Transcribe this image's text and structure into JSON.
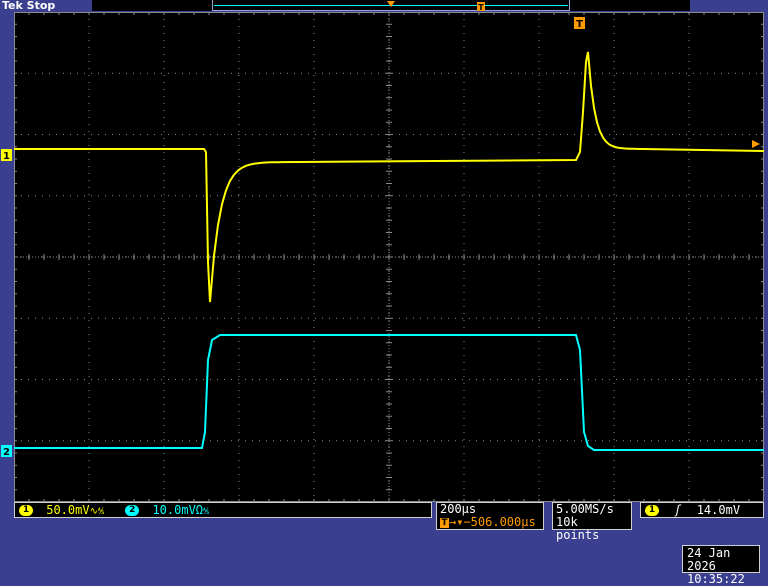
{
  "header": {
    "brand": "Tek Stop",
    "trigger_pos_marker": "T"
  },
  "screen": {
    "trigger_marker": "T",
    "ch1_marker": "1",
    "ch2_marker": "2",
    "colors": {
      "ch1": "#ffff00",
      "ch2": "#00ffff",
      "grid": "#8a8a8a",
      "background": "#000000"
    }
  },
  "status": {
    "ch1_badge": "1",
    "ch1_scale": "50.0mV",
    "ch1_suffix": "∿⅍",
    "ch2_badge": "2",
    "ch2_scale": "10.0mVΩ",
    "ch2_suffix": "⅍",
    "timebase": "200µs",
    "trigger_icon": "T",
    "trigger_offset": "→▾−506.000µs",
    "sample_rate": "5.00MS/s",
    "record_length": "10k points",
    "trig_source_badge": "1",
    "trig_slope": "ʃ",
    "trig_level": "14.0mV",
    "date": "24 Jan  2026",
    "time": "10:35:22"
  }
}
